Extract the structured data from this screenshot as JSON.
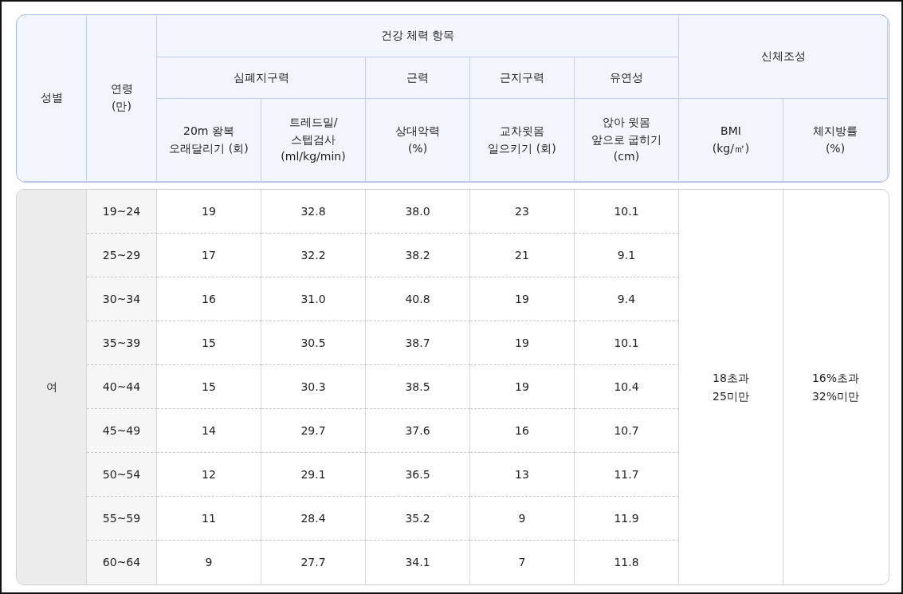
{
  "header": {
    "gender": "성별",
    "age": "연령\n(만)",
    "groups": [
      {
        "title": "건강 체력 항목",
        "subgroups": [
          {
            "title": "심폐지구력",
            "items": [
              "20m 왕복\n오래달리기 (회)",
              "트레드밀/\n스텝검사\n(ml/kg/min)"
            ]
          },
          {
            "title": "근력",
            "items": [
              "상대악력\n(%)"
            ]
          },
          {
            "title": "근지구력",
            "items": [
              "교차윗몸\n일으키기 (회)"
            ]
          },
          {
            "title": "유연성",
            "items": [
              "앉아 윗몸\n앞으로 굽히기\n(cm)"
            ]
          }
        ]
      },
      {
        "title": "신체조성",
        "items": [
          "BMI\n(kg/㎡)",
          "체지방률\n(%)"
        ]
      }
    ]
  },
  "body": {
    "gender": "여",
    "bmi": "18초과\n25미만",
    "body_fat": "16%초과\n32%미만",
    "rows": [
      {
        "age": "19~24",
        "values": [
          "19",
          "32.8",
          "38.0",
          "23",
          "10.1"
        ]
      },
      {
        "age": "25~29",
        "values": [
          "17",
          "32.2",
          "38.2",
          "21",
          "9.1"
        ]
      },
      {
        "age": "30~34",
        "values": [
          "16",
          "31.0",
          "40.8",
          "19",
          "9.4"
        ]
      },
      {
        "age": "35~39",
        "values": [
          "15",
          "30.5",
          "38.7",
          "19",
          "10.1"
        ]
      },
      {
        "age": "40~44",
        "values": [
          "15",
          "30.3",
          "38.5",
          "19",
          "10.4"
        ]
      },
      {
        "age": "45~49",
        "values": [
          "14",
          "29.7",
          "37.6",
          "16",
          "10.7"
        ]
      },
      {
        "age": "50~54",
        "values": [
          "12",
          "29.1",
          "36.5",
          "13",
          "11.7"
        ]
      },
      {
        "age": "55~59",
        "values": [
          "11",
          "28.4",
          "35.2",
          "9",
          "11.9"
        ]
      },
      {
        "age": "60~64",
        "values": [
          "9",
          "27.7",
          "34.1",
          "7",
          "11.8"
        ]
      }
    ]
  }
}
